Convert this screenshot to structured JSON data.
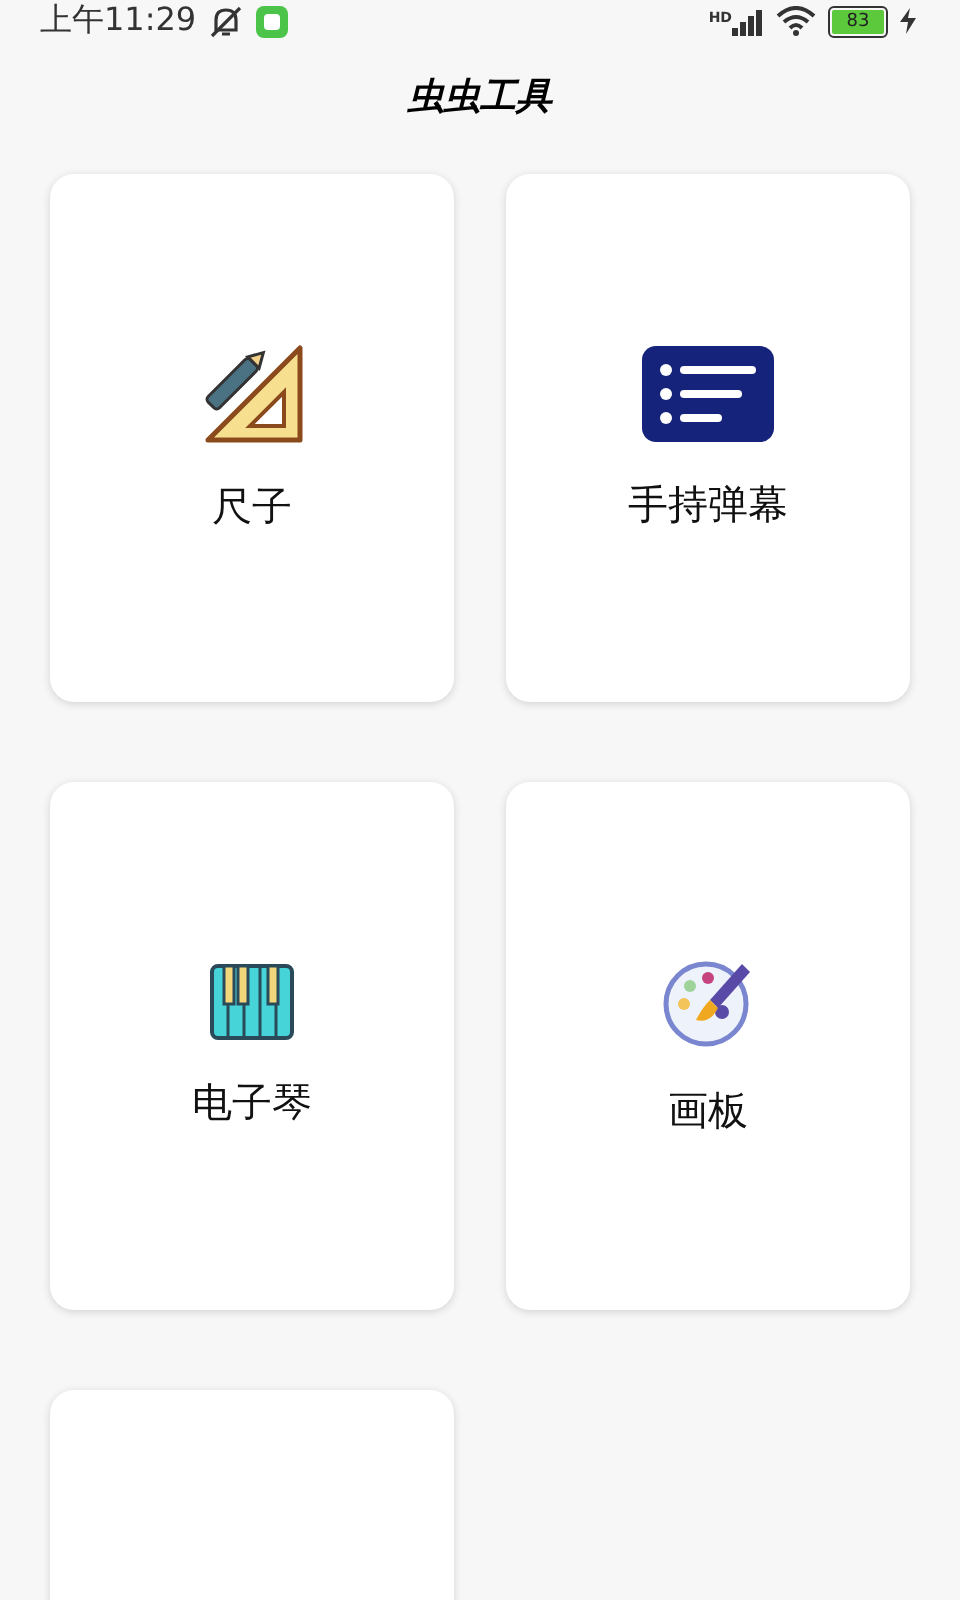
{
  "status_bar": {
    "time": "上午11:29",
    "network": "HD",
    "battery": "83"
  },
  "header": {
    "title": "虫虫工具"
  },
  "tools": [
    {
      "kind": "ruler",
      "label": "尺子"
    },
    {
      "kind": "barrage",
      "label": "手持弹幕"
    },
    {
      "kind": "piano",
      "label": "电子琴"
    },
    {
      "kind": "palette",
      "label": "画板"
    },
    {
      "kind": "empty"
    }
  ]
}
